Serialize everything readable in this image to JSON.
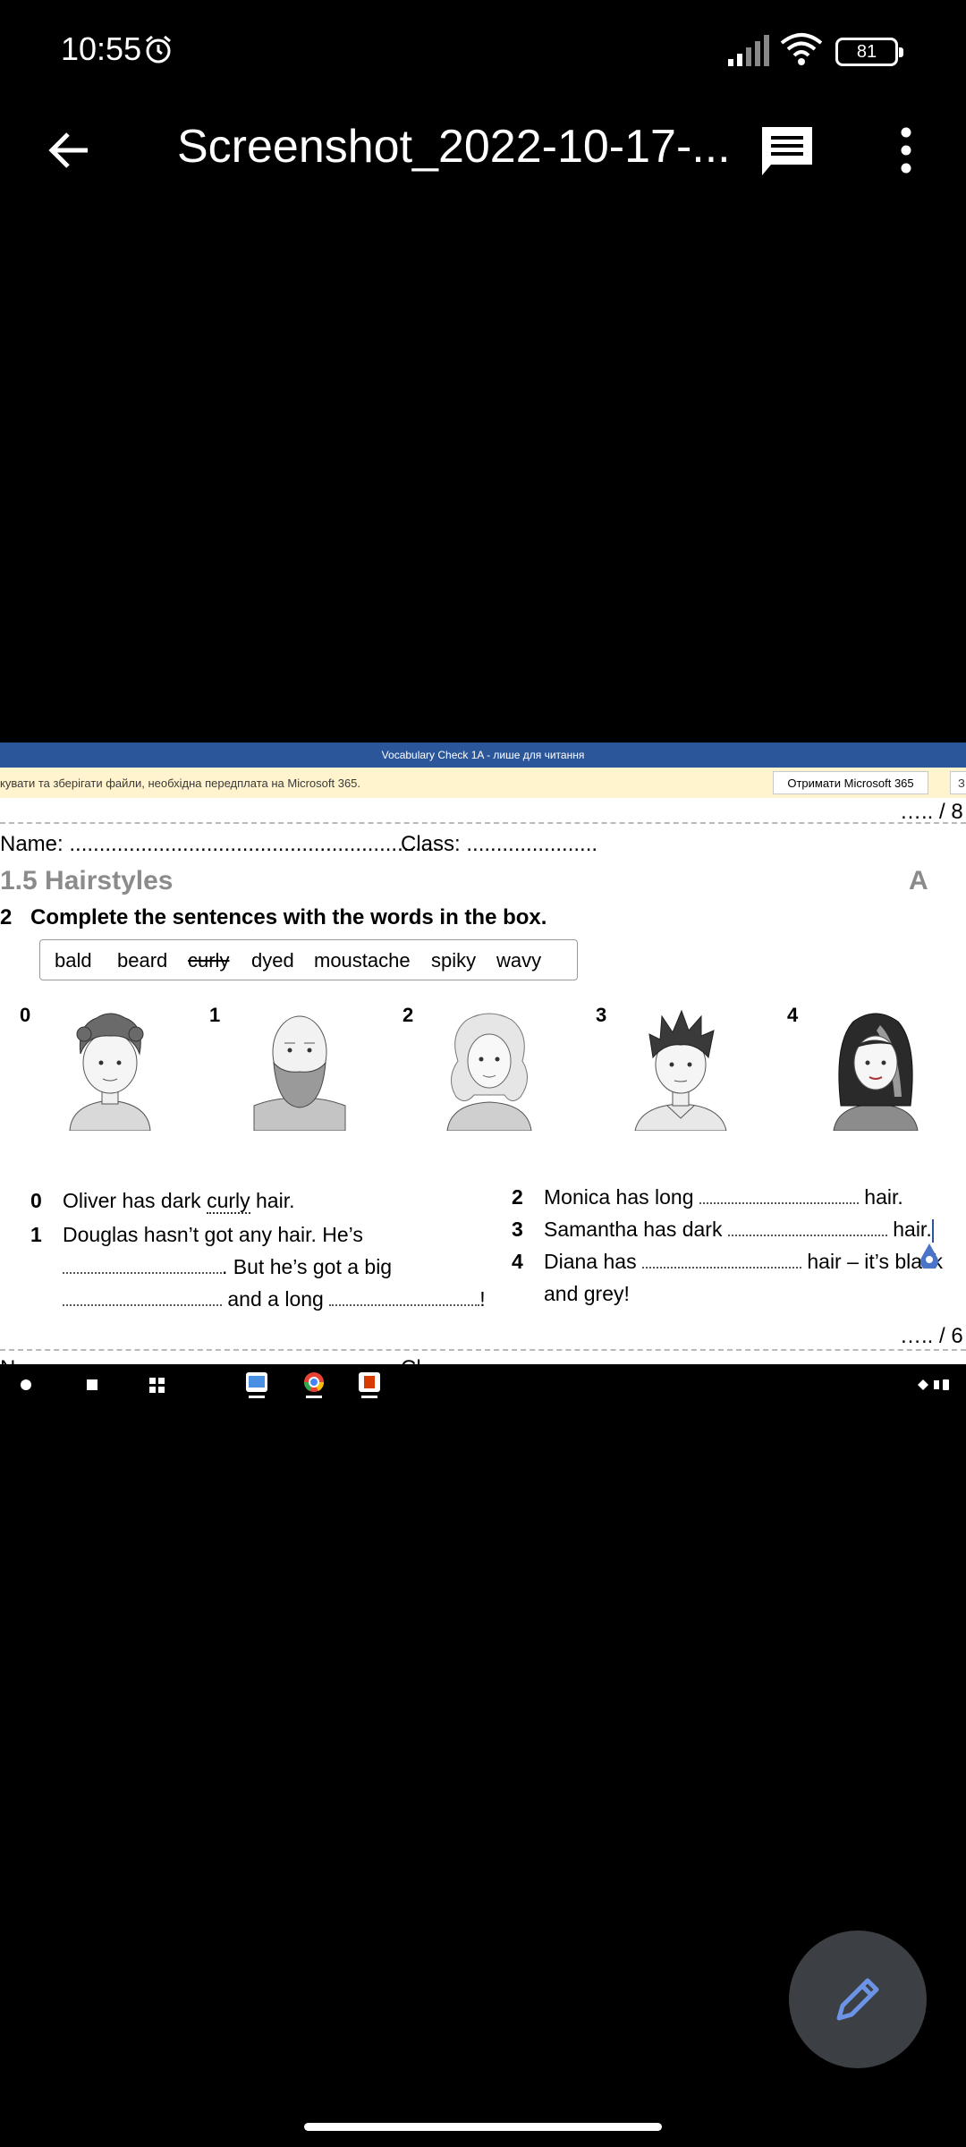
{
  "status_bar": {
    "time": "10:55",
    "battery": "81"
  },
  "app_bar": {
    "title": "Screenshot_2022-10-17-..."
  },
  "word_viewer": {
    "doc_title": "Vocabulary Check 1A - лише для читання",
    "banner_message": "кувати та зберігати файли, необхідна передплата на Microsoft 365.",
    "get_button": "Отримати Microsoft 365",
    "banner_extra": "З"
  },
  "worksheet": {
    "top_score": "….. / 8",
    "name_label": "Name:",
    "name_dots": "..............................................................",
    "class_label": "Class:",
    "class_dots": "......................",
    "heading": "1.5 Hairstyles",
    "level": "A",
    "exercise_number": "2",
    "instruction": "Complete the sentences with the words in the box.",
    "word_box": [
      "bald",
      "beard",
      "curly",
      "dyed",
      "moustache",
      "spiky",
      "wavy"
    ],
    "picture_numbers": [
      "0",
      "1",
      "2",
      "3",
      "4"
    ],
    "sentences": {
      "s0_num": "0",
      "s0_a": "Oliver has dark ",
      "s0_word": "curly",
      "s0_b": " hair.",
      "s1_num": "1",
      "s1_line1": "Douglas hasn’t got any hair. He’s",
      "s1_line2_end": ". But he’s got a big",
      "s1_line3_mid": " and a long ",
      "s1_line3_end": "!",
      "s2_num": "2",
      "s2_a": "Monica has long ",
      "s2_b": " hair.",
      "s3_num": "3",
      "s3_a": "Samantha has dark ",
      "s3_b": " hair.",
      "s4_num": "4",
      "s4_a": "Diana has ",
      "s4_b": " hair – it’s black",
      "s4_line2": "and grey!"
    },
    "bottom_score": "….. / 6",
    "cut_text_left": "N",
    "cut_text_right": "Cl"
  }
}
